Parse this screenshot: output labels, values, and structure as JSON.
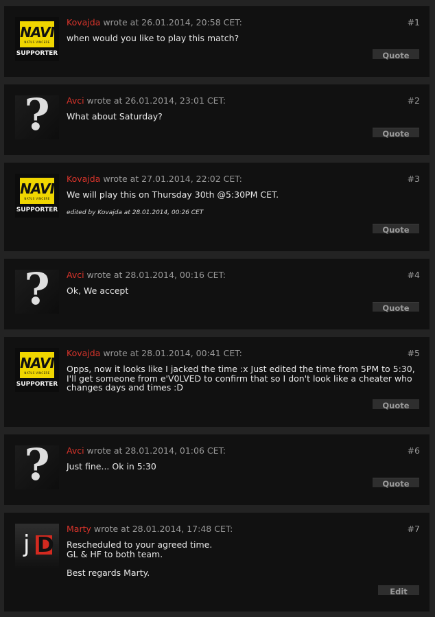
{
  "posts": [
    {
      "author": "Kovajda",
      "meta": " wrote at 26.01.2014, 20:58 CET:",
      "number": "#1",
      "avatar": "navi",
      "lines": [
        "when would you like to play this match?"
      ],
      "button": "Quote"
    },
    {
      "author": "Avci",
      "meta": " wrote at 26.01.2014, 23:01 CET:",
      "number": "#2",
      "avatar": "question",
      "lines": [
        "What about Saturday?"
      ],
      "button": "Quote"
    },
    {
      "author": "Kovajda",
      "meta": " wrote at 27.01.2014, 22:02 CET:",
      "number": "#3",
      "avatar": "navi",
      "lines": [
        "We will play this on Thursday 30th @5:30PM CET."
      ],
      "edited": "edited by Kovajda at 28.01.2014, 00:26 CET",
      "button": "Quote"
    },
    {
      "author": "Avci",
      "meta": " wrote at 28.01.2014, 00:16 CET:",
      "number": "#4",
      "avatar": "question",
      "lines": [
        "Ok, We accept"
      ],
      "button": "Quote"
    },
    {
      "author": "Kovajda",
      "meta": " wrote at 28.01.2014, 00:41 CET:",
      "number": "#5",
      "avatar": "navi",
      "lines": [
        "Opps, now it looks like I jacked the time :x Just edited the time from 5PM to 5:30, I'll get someone from e'V0LVED to confirm that so I don't look like a cheater who changes days and times :D"
      ],
      "button": "Quote"
    },
    {
      "author": "Avci",
      "meta": " wrote at 28.01.2014, 01:06 CET:",
      "number": "#6",
      "avatar": "question",
      "lines": [
        "Just fine... Ok in 5:30"
      ],
      "button": "Quote"
    },
    {
      "author": "Marty",
      "meta": " wrote at 28.01.2014, 17:48 CET:",
      "number": "#7",
      "avatar": "jd",
      "lines": [
        "Rescheduled to your agreed time.\nGL & HF to both team.\n\nBest regards Marty."
      ],
      "button": "Edit"
    }
  ],
  "avatars": {
    "navi": {
      "logo": "NAVI",
      "sub": "NATUS VINCERE",
      "label": "SUPPORTER"
    },
    "question": {
      "glyph": "?"
    },
    "jd": {
      "j": "j",
      "d": "D"
    }
  },
  "colors": {
    "author": "#d9342b",
    "background": "#232323",
    "post_bg": "#111111",
    "navi_yellow": "#f0d600",
    "jd_red": "#d22a20"
  }
}
